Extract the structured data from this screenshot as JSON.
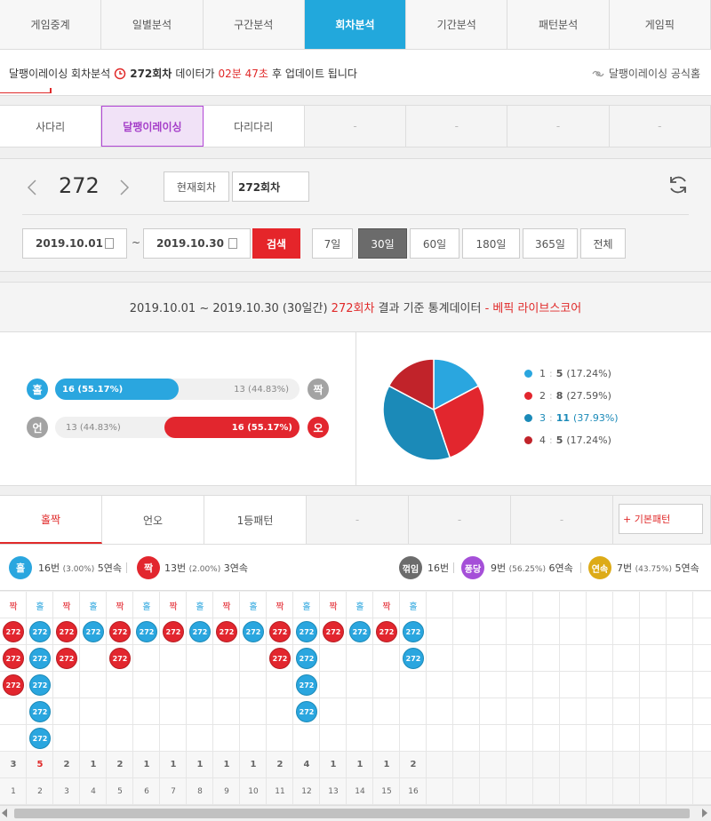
{
  "top_tabs": [
    "게임중계",
    "일별분석",
    "구간분석",
    "회차분석",
    "기간분석",
    "패턴분석",
    "게임픽"
  ],
  "top_tabs_active": 3,
  "notice": {
    "prefix": "달팽이레이싱 회차분석",
    "round": "272회차",
    "mid": "데이터가",
    "countdown": "02분 47초",
    "suffix": "후 업데이트 됩니다",
    "homepage_link": "달팽이레이싱 공식홈"
  },
  "game_tabs": [
    "사다리",
    "달팽이레이싱",
    "다리다리",
    "-",
    "-",
    "-",
    "-"
  ],
  "game_tabs_active": 1,
  "round_nav": {
    "round_number": "272",
    "current_round_button": "현재회차",
    "round_input_value": "272회차",
    "date_from": "2019.10.01",
    "date_to": "2019.10.30",
    "tilde": "~",
    "search_button": "검색",
    "periods": [
      "7일",
      "30일",
      "60일",
      "180일",
      "365일",
      "전체"
    ],
    "period_active": 1
  },
  "stats": {
    "header_prefix": "2019.10.01 ~ 2019.10.30 (30일간)",
    "header_round": "272회차",
    "header_mid": "결과 기준 통계데이터",
    "header_brand": "- 베픽 라이브스코어",
    "odd_label": "홀",
    "even_label": "짝",
    "odd_text": "16 (55.17%)",
    "even_text": "13 (44.83%)",
    "odd_fraction": 0.5517,
    "un_label": "언",
    "over_label": "오",
    "un_text": "13 (44.83%)",
    "over_text": "16 (55.17%)",
    "over_fraction": 0.5517,
    "legend": [
      {
        "num": "1",
        "value": "5",
        "pct": "(17.24%)",
        "color": "#2aa6df"
      },
      {
        "num": "2",
        "value": "8",
        "pct": "(27.59%)",
        "color": "#e2262e"
      },
      {
        "num": "3",
        "value": "11",
        "pct": "(37.93%)",
        "color": "#1b8ab8"
      },
      {
        "num": "4",
        "value": "5",
        "pct": "(17.24%)",
        "color": "#c1232a"
      }
    ]
  },
  "pattern_tabs": [
    "홀짝",
    "언오",
    "1등패턴",
    "-",
    "-",
    "-"
  ],
  "pattern_tabs_active": 0,
  "basic_pattern_button": "+ 기본패턴",
  "summary": {
    "odd_label": "홀",
    "odd_count": "16번",
    "odd_pct": "(3.00%)",
    "odd_streak": "5연속",
    "even_label": "짝",
    "even_count": "13번",
    "even_pct": "(2.00%)",
    "even_streak": "3연속",
    "break_label": "꺾임",
    "break_count": "16번",
    "pong_label": "퐁당",
    "pong_count": "9번",
    "pong_pct": "(56.25%)",
    "pong_streak": "6연속",
    "cont_label": "연속",
    "cont_count": "7번",
    "cont_pct": "(43.75%)",
    "cont_streak": "5연속"
  },
  "grid": {
    "columns": [
      {
        "head": "짝",
        "count": 3,
        "num": "1"
      },
      {
        "head": "홀",
        "count": 5,
        "num": "2"
      },
      {
        "head": "짝",
        "count": 2,
        "num": "3"
      },
      {
        "head": "홀",
        "count": 1,
        "num": "4"
      },
      {
        "head": "짝",
        "count": 2,
        "num": "5"
      },
      {
        "head": "홀",
        "count": 1,
        "num": "6"
      },
      {
        "head": "짝",
        "count": 1,
        "num": "7"
      },
      {
        "head": "홀",
        "count": 1,
        "num": "8"
      },
      {
        "head": "짝",
        "count": 1,
        "num": "9"
      },
      {
        "head": "홀",
        "count": 1,
        "num": "10"
      },
      {
        "head": "짝",
        "count": 2,
        "num": "11"
      },
      {
        "head": "홀",
        "count": 4,
        "num": "12"
      },
      {
        "head": "짝",
        "count": 1,
        "num": "13"
      },
      {
        "head": "홀",
        "count": 1,
        "num": "14"
      },
      {
        "head": "짝",
        "count": 1,
        "num": "15"
      },
      {
        "head": "홀",
        "count": 2,
        "num": "16"
      }
    ],
    "ball_label": "272",
    "max_streak_column": 2
  }
}
